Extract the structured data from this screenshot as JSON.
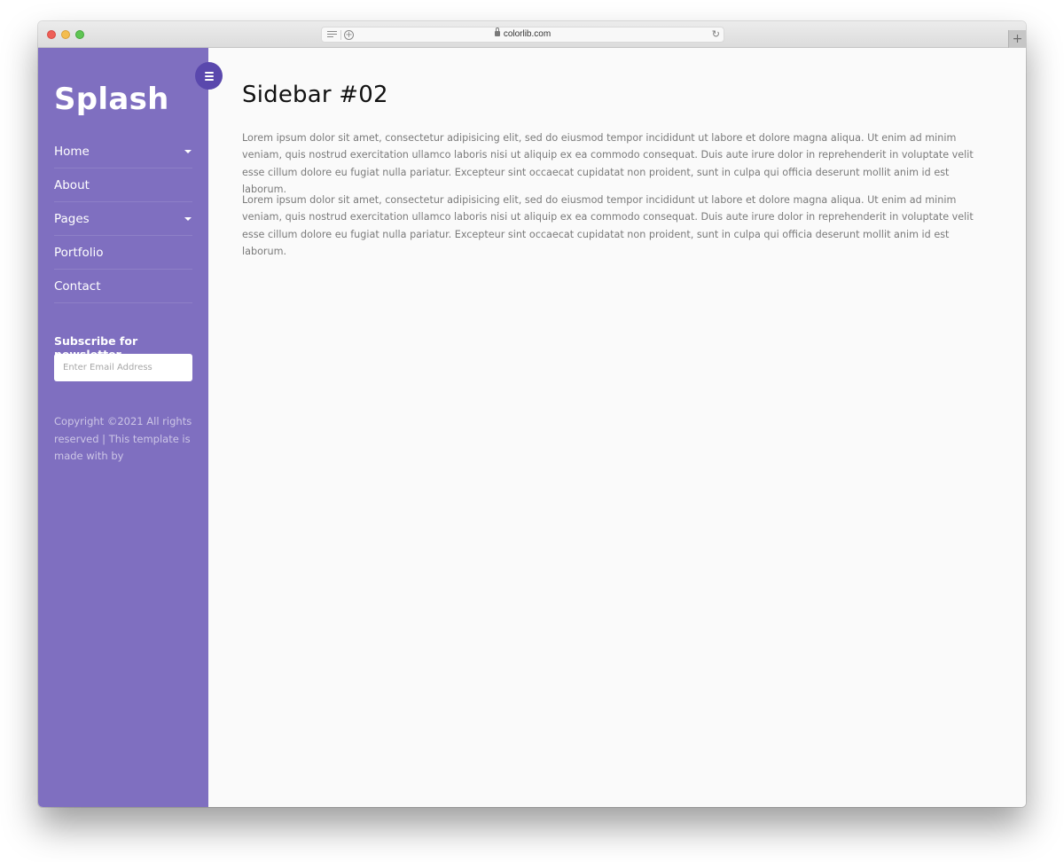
{
  "browser": {
    "url": "colorlib.com",
    "icons": {
      "reader": "reader-view-icon",
      "add": "add-circle-icon",
      "lock": "lock-icon",
      "reload": "reload-icon",
      "new_tab": "plus-icon"
    },
    "reload_glyph": "↻",
    "add_glyph": "+",
    "new_tab_glyph": "+"
  },
  "sidebar": {
    "background": "#7f6fc0",
    "toggle_color": "#5a48ad",
    "logo": "Splash",
    "nav": [
      {
        "label": "Home",
        "has_dropdown": true
      },
      {
        "label": "About",
        "has_dropdown": false
      },
      {
        "label": "Pages",
        "has_dropdown": true
      },
      {
        "label": "Portfolio",
        "has_dropdown": false
      },
      {
        "label": "Contact",
        "has_dropdown": false
      }
    ],
    "newsletter": {
      "title": "Subscribe for newsletter",
      "placeholder": "Enter Email Address",
      "value": ""
    },
    "copyright": "Copyright ©2021 All rights reserved | This template is made with by"
  },
  "main": {
    "title": "Sidebar #02",
    "paragraphs": [
      "Lorem ipsum dolor sit amet, consectetur adipisicing elit, sed do eiusmod tempor incididunt ut labore et dolore magna aliqua. Ut enim ad minim veniam, quis nostrud exercitation ullamco laboris nisi ut aliquip ex ea commodo consequat. Duis aute irure dolor in reprehenderit in voluptate velit esse cillum dolore eu fugiat nulla pariatur. Excepteur sint occaecat cupidatat non proident, sunt in culpa qui officia deserunt mollit anim id est laborum.",
      "Lorem ipsum dolor sit amet, consectetur adipisicing elit, sed do eiusmod tempor incididunt ut labore et dolore magna aliqua. Ut enim ad minim veniam, quis nostrud exercitation ullamco laboris nisi ut aliquip ex ea commodo consequat. Duis aute irure dolor in reprehenderit in voluptate velit esse cillum dolore eu fugiat nulla pariatur. Excepteur sint occaecat cupidatat non proident, sunt in culpa qui officia deserunt mollit anim id est laborum."
    ]
  }
}
